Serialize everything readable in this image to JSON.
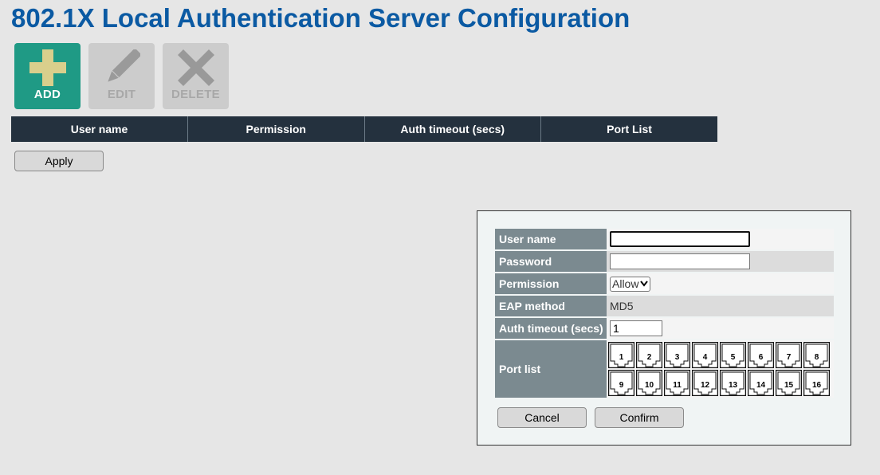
{
  "page": {
    "title": "802.1X Local Authentication Server Configuration"
  },
  "toolbar": {
    "add": {
      "label": "ADD",
      "icon": "plus-icon",
      "color": "#1f9a85"
    },
    "edit": {
      "label": "EDIT",
      "icon": "pencil-icon"
    },
    "delete": {
      "label": "DELETE",
      "icon": "x-icon"
    }
  },
  "table": {
    "columns": [
      "User name",
      "Permission",
      "Auth timeout (secs)",
      "Port List"
    ],
    "rows": []
  },
  "actions": {
    "apply_label": "Apply"
  },
  "dialog": {
    "fields": {
      "username": {
        "label": "User name",
        "value": ""
      },
      "password": {
        "label": "Password",
        "value": ""
      },
      "permission": {
        "label": "Permission",
        "value": "Allow",
        "options": [
          "Allow"
        ]
      },
      "eap_method": {
        "label": "EAP method",
        "value": "MD5"
      },
      "auth_timeout": {
        "label": "Auth timeout (secs)",
        "value": "1"
      },
      "port_list": {
        "label": "Port list",
        "ports": [
          "1",
          "2",
          "3",
          "4",
          "5",
          "6",
          "7",
          "8",
          "9",
          "10",
          "11",
          "12",
          "13",
          "14",
          "15",
          "16"
        ]
      }
    },
    "cancel_label": "Cancel",
    "confirm_label": "Confirm"
  }
}
